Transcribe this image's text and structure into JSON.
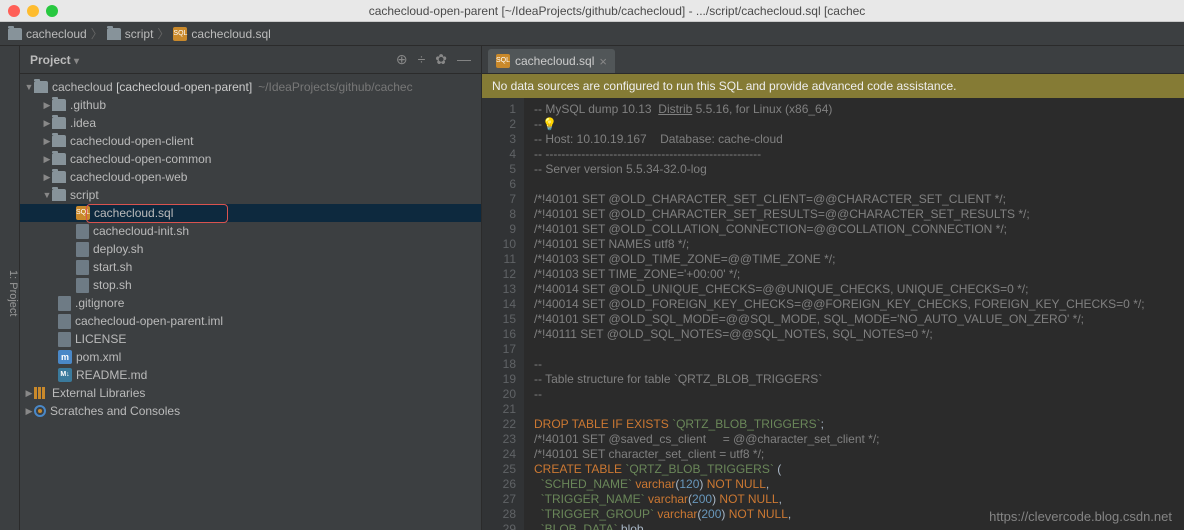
{
  "window": {
    "title": "cachecloud-open-parent [~/IdeaProjects/github/cachecloud] - .../script/cachecloud.sql [cachec"
  },
  "breadcrumb": {
    "items": [
      "cachecloud",
      "script",
      "cachecloud.sql"
    ]
  },
  "panel": {
    "title": "Project"
  },
  "sidebar_tab": "1: Project",
  "tree": {
    "root": {
      "label": "cachecloud",
      "module": "[cachecloud-open-parent]",
      "path": "~/IdeaProjects/github/cachec"
    },
    "folders": [
      ".github",
      ".idea"
    ],
    "modules": [
      "cachecloud-open-client",
      "cachecloud-open-common",
      "cachecloud-open-web"
    ],
    "script": {
      "label": "script",
      "files": [
        "cachecloud.sql",
        "cachecloud-init.sh",
        "deploy.sh",
        "start.sh",
        "stop.sh"
      ]
    },
    "root_files": [
      {
        "name": ".gitignore",
        "icon": "file"
      },
      {
        "name": "cachecloud-open-parent.iml",
        "icon": "file"
      },
      {
        "name": "LICENSE",
        "icon": "file"
      },
      {
        "name": "pom.xml",
        "icon": "m"
      },
      {
        "name": "README.md",
        "icon": "md"
      }
    ],
    "external": "External Libraries",
    "scratches": "Scratches and Consoles"
  },
  "editor": {
    "tab_name": "cachecloud.sql",
    "banner": "No data sources are configured to run this SQL and provide advanced code assistance.",
    "lines": [
      {
        "n": 1,
        "type": "cmt",
        "text": "-- MySQL dump 10.13  Distrib 5.5.16, for Linux (x86_64)"
      },
      {
        "n": 2,
        "type": "bulb",
        "text": "--"
      },
      {
        "n": 3,
        "type": "cmt",
        "text": "-- Host: 10.10.19.167    Database: cache-cloud"
      },
      {
        "n": 4,
        "type": "cmt",
        "text": "-- ------------------------------------------------------"
      },
      {
        "n": 5,
        "type": "cmt",
        "text": "-- Server version 5.5.34-32.0-log"
      },
      {
        "n": 6,
        "type": "blank",
        "text": ""
      },
      {
        "n": 7,
        "type": "cmt",
        "text": "/*!40101 SET @OLD_CHARACTER_SET_CLIENT=@@CHARACTER_SET_CLIENT */;"
      },
      {
        "n": 8,
        "type": "cmt",
        "text": "/*!40101 SET @OLD_CHARACTER_SET_RESULTS=@@CHARACTER_SET_RESULTS */;"
      },
      {
        "n": 9,
        "type": "cmt",
        "text": "/*!40101 SET @OLD_COLLATION_CONNECTION=@@COLLATION_CONNECTION */;"
      },
      {
        "n": 10,
        "type": "cmt",
        "text": "/*!40101 SET NAMES utf8 */;"
      },
      {
        "n": 11,
        "type": "cmt",
        "text": "/*!40103 SET @OLD_TIME_ZONE=@@TIME_ZONE */;"
      },
      {
        "n": 12,
        "type": "cmt",
        "text": "/*!40103 SET TIME_ZONE='+00:00' */;"
      },
      {
        "n": 13,
        "type": "cmt",
        "text": "/*!40014 SET @OLD_UNIQUE_CHECKS=@@UNIQUE_CHECKS, UNIQUE_CHECKS=0 */;"
      },
      {
        "n": 14,
        "type": "cmt",
        "text": "/*!40014 SET @OLD_FOREIGN_KEY_CHECKS=@@FOREIGN_KEY_CHECKS, FOREIGN_KEY_CHECKS=0 */;"
      },
      {
        "n": 15,
        "type": "cmt",
        "text": "/*!40101 SET @OLD_SQL_MODE=@@SQL_MODE, SQL_MODE='NO_AUTO_VALUE_ON_ZERO' */;"
      },
      {
        "n": 16,
        "type": "cmt",
        "text": "/*!40111 SET @OLD_SQL_NOTES=@@SQL_NOTES, SQL_NOTES=0 */;"
      },
      {
        "n": 17,
        "type": "blank",
        "text": ""
      },
      {
        "n": 18,
        "type": "cmt",
        "text": "--"
      },
      {
        "n": 19,
        "type": "cmt",
        "text": "-- Table structure for table `QRTZ_BLOB_TRIGGERS`"
      },
      {
        "n": 20,
        "type": "cmt",
        "text": "--"
      },
      {
        "n": 21,
        "type": "blank",
        "text": ""
      },
      {
        "n": 22,
        "type": "sql",
        "html": "<span class='kw'>DROP TABLE</span> <span class='kw'>IF</span> <span class='kw'>EXISTS</span> <span class='str'>`QRTZ_BLOB_TRIGGERS`</span>;"
      },
      {
        "n": 23,
        "type": "cmt",
        "text": "/*!40101 SET @saved_cs_client     = @@character_set_client */;"
      },
      {
        "n": 24,
        "type": "cmt",
        "text": "/*!40101 SET character_set_client = utf8 */;"
      },
      {
        "n": 25,
        "type": "sql",
        "html": "<span class='kw'>CREATE TABLE</span> <span class='str'>`QRTZ_BLOB_TRIGGERS`</span> ("
      },
      {
        "n": 26,
        "type": "sql",
        "html": "  <span class='str'>`SCHED_NAME`</span> <span class='kw'>varchar</span>(<span class='num'>120</span>) <span class='kw'>NOT NULL</span>,"
      },
      {
        "n": 27,
        "type": "sql",
        "html": "  <span class='str'>`TRIGGER_NAME`</span> <span class='kw'>varchar</span>(<span class='num'>200</span>) <span class='kw'>NOT NULL</span>,"
      },
      {
        "n": 28,
        "type": "sql",
        "html": "  <span class='str'>`TRIGGER_GROUP`</span> <span class='kw'>varchar</span>(<span class='num'>200</span>) <span class='kw'>NOT NULL</span>,"
      },
      {
        "n": 29,
        "type": "sql",
        "html": "  <span class='str'>`BLOB_DATA`</span> blob,"
      }
    ]
  },
  "watermark": "https://clevercode.blog.csdn.net"
}
